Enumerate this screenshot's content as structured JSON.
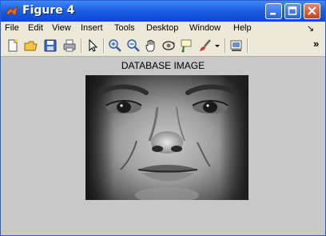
{
  "window": {
    "title": "Figure 4"
  },
  "menu": {
    "items": [
      "File",
      "Edit",
      "View",
      "Insert",
      "Tools",
      "Desktop",
      "Window",
      "Help",
      "↘"
    ]
  },
  "toolbar": {
    "buttons": [
      "new-figure-icon",
      "open-file-icon",
      "save-icon",
      "print-icon",
      "pointer-icon",
      "zoom-in-icon",
      "zoom-out-icon",
      "pan-icon",
      "rotate-3d-icon",
      "data-cursor-icon",
      "brush-icon",
      "dropdown-arrow-icon",
      "insert-colorbar-icon",
      "toolbar-overflow-icon"
    ],
    "overflow_label": "»"
  },
  "figure": {
    "axes_title": "DATABASE IMAGE"
  }
}
